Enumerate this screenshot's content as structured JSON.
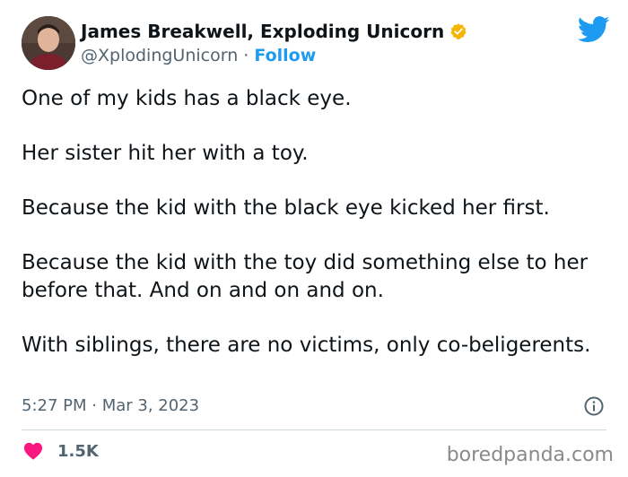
{
  "author": {
    "name": "James Breakwell, Exploding Unicorn",
    "handle": "@XplodingUnicorn",
    "separator": " · ",
    "follow_label": "Follow",
    "verified_color": "#f4b400",
    "avatar_icon": "avatar-photo"
  },
  "brand": {
    "logo_icon": "twitter-bird-icon",
    "logo_color": "#1d9bf0"
  },
  "tweet": {
    "paragraphs": [
      "One of my kids has a black eye.",
      "Her sister hit her with a toy.",
      "Because the kid with the black eye kicked her first.",
      "Because the kid with the toy did something else to her before that. And on and on and on.",
      "With siblings, there are no victims, only co-beligerents."
    ],
    "timestamp": "5:27 PM · Mar 3, 2023"
  },
  "engagement": {
    "likes": "1.5K",
    "heart_color": "#f91880"
  },
  "watermark": "boredpanda.com"
}
